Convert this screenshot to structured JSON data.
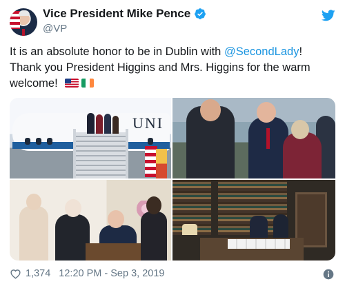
{
  "author": {
    "display_name": "Vice President Mike Pence",
    "handle": "@VP",
    "verified": true,
    "avatar_icon": "avatar-photo"
  },
  "tweet": {
    "text_part1": "It is an absolute honor to be in Dublin with ",
    "mention": "@SecondLady",
    "text_part2": "! Thank you President Higgins and Mrs. Higgins  for the warm welcome! ",
    "emojis": [
      "us-flag-emoji",
      "ireland-flag-emoji"
    ]
  },
  "media": {
    "photos": [
      {
        "name": "photo-airplane-arrival"
      },
      {
        "name": "photo-greeting"
      },
      {
        "name": "photo-signing-desk"
      },
      {
        "name": "photo-library-room"
      }
    ],
    "plane_lettering": "UNI"
  },
  "footer": {
    "like_count": "1,374",
    "timestamp": "12:20 PM - Sep 3, 2019"
  },
  "colors": {
    "link": "#1b95e0",
    "verified": "#1da1f2",
    "secondary_text": "#657786"
  },
  "icons": {
    "logo": "twitter-bird-icon",
    "verified": "verified-badge-icon",
    "like": "heart-icon",
    "info": "info-icon"
  }
}
